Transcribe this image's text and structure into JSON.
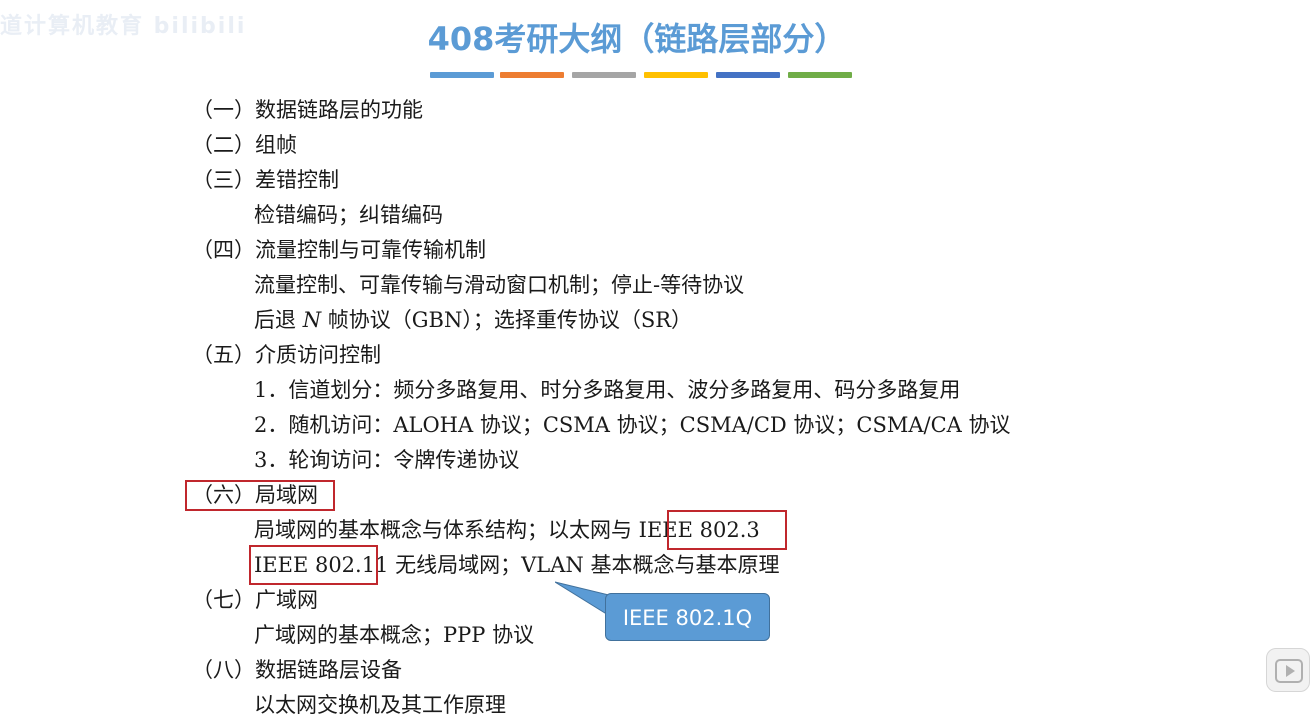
{
  "watermark": "道计算机教育 bilibili",
  "title": "408考研大纲（链路层部分）",
  "colors": {
    "title": "#5b9bd5",
    "bars": [
      "#5b9bd5",
      "#ed7d31",
      "#a5a5a5",
      "#ffc000",
      "#4472c4",
      "#70ad47"
    ],
    "highlight_box": "#c0272d",
    "callout_bg": "#5b9bd5"
  },
  "outline": {
    "s1": "（一）数据链路层的功能",
    "s2": "（二）组帧",
    "s3": "（三）差错控制",
    "s3_1": "检错编码；纠错编码",
    "s4": "（四）流量控制与可靠传输机制",
    "s4_1": "流量控制、可靠传输与滑动窗口机制；停止-等待协议",
    "s4_2a": "后退 ",
    "s4_2n": "N",
    "s4_2b": " 帧协议（GBN）；选择重传协议（SR）",
    "s5": "（五）介质访问控制",
    "s5_1": "1．信道划分：频分多路复用、时分多路复用、波分多路复用、码分多路复用",
    "s5_2": "2．随机访问：ALOHA 协议；CSMA 协议；CSMA/CD 协议；CSMA/CA 协议",
    "s5_3": "3．轮询访问：令牌传递协议",
    "s6": "（六）局域网",
    "s6_1": "局域网的基本概念与体系结构；以太网与 IEEE 802.3",
    "s6_2": "IEEE 802.11 无线局域网；VLAN 基本概念与基本原理",
    "s7": "（七）广域网",
    "s7_1": "广域网的基本概念；PPP 协议",
    "s8": "（八）数据链路层设备",
    "s8_1": "以太网交换机及其工作原理"
  },
  "callout": {
    "text": "IEEE 802.1Q"
  },
  "player": {
    "icon": "play-icon"
  }
}
